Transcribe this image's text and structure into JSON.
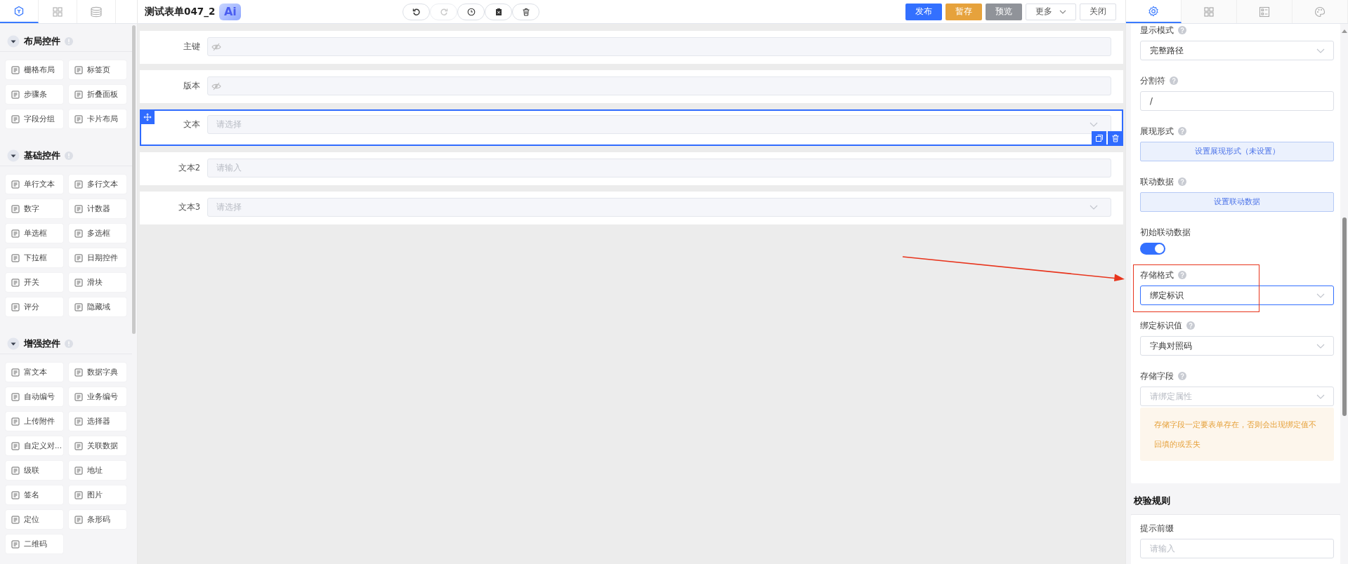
{
  "left_tabs": [
    {
      "selected": true
    },
    {
      "selected": false
    },
    {
      "selected": false
    }
  ],
  "title": "测试表单047_2",
  "ai_badge": "Ai",
  "toolbar": [
    {
      "disabled": false
    },
    {
      "disabled": true
    },
    {
      "disabled": false
    },
    {
      "disabled": false
    },
    {
      "disabled": false
    }
  ],
  "actions": [
    {
      "label": "发布",
      "kind": "primary"
    },
    {
      "label": "暂存",
      "kind": "warning"
    },
    {
      "label": "预览",
      "kind": "info"
    },
    {
      "label": "更多",
      "kind": "dropdown"
    },
    {
      "label": "关闭",
      "kind": "plain"
    }
  ],
  "palette": [
    {
      "title": "布局控件",
      "expanded": true,
      "items": [
        "栅格布局",
        "标签页",
        "步骤条",
        "折叠面板",
        "字段分组",
        "卡片布局"
      ]
    },
    {
      "title": "基础控件",
      "expanded": true,
      "items": [
        "单行文本",
        "多行文本",
        "数字",
        "计数器",
        "单选框",
        "多选框",
        "下拉框",
        "日期控件",
        "开关",
        "滑块",
        "评分",
        "隐藏域"
      ]
    },
    {
      "title": "增强控件",
      "expanded": true,
      "items": [
        "富文本",
        "数据字典",
        "自动编号",
        "业务编号",
        "上传附件",
        "选择器",
        "自定义对...",
        "关联数据",
        "级联",
        "地址",
        "签名",
        "图片",
        "定位",
        "条形码",
        "二维码"
      ]
    }
  ],
  "form_fields": [
    {
      "label": "主键",
      "kind": "hidden",
      "selected": false
    },
    {
      "label": "版本",
      "kind": "hidden",
      "selected": false
    },
    {
      "label": "文本",
      "kind": "select",
      "placeholder": "请选择",
      "selected": true
    },
    {
      "label": "文本2",
      "kind": "input",
      "placeholder": "请输入",
      "selected": false
    },
    {
      "label": "文本3",
      "kind": "select",
      "placeholder": "请选择",
      "selected": false
    }
  ],
  "properties_tabs": [
    {
      "selected": true
    },
    {
      "selected": false
    },
    {
      "selected": false
    },
    {
      "selected": false
    }
  ],
  "properties": [
    {
      "label": "显示模式",
      "help": true,
      "kind": "select",
      "value": "完整路径",
      "focused": false
    },
    {
      "label": "分割符",
      "help": true,
      "kind": "input",
      "value": "/"
    },
    {
      "label": "展现形式",
      "help": true,
      "kind": "button",
      "text": "设置展现形式（未设置）"
    },
    {
      "label": "联动数据",
      "help": true,
      "kind": "button",
      "text": "设置联动数据"
    },
    {
      "label": "初始联动数据",
      "help": false,
      "kind": "switch",
      "on": true
    },
    {
      "label": "存储格式",
      "help": true,
      "kind": "select",
      "value": "绑定标识",
      "focused": true,
      "highlighted": true
    },
    {
      "label": "绑定标识值",
      "help": true,
      "kind": "select",
      "value": "字典对照码",
      "focused": false
    },
    {
      "label": "存储字段",
      "help": true,
      "kind": "select",
      "placeholder": "请绑定属性",
      "focused": false,
      "note": "存储字段一定要表单存在，否则会出现绑定值不回填的或丢失"
    }
  ],
  "validation": {
    "title": "校验规则",
    "fields": [
      {
        "label": "提示前缀",
        "placeholder": "请输入"
      }
    ]
  }
}
